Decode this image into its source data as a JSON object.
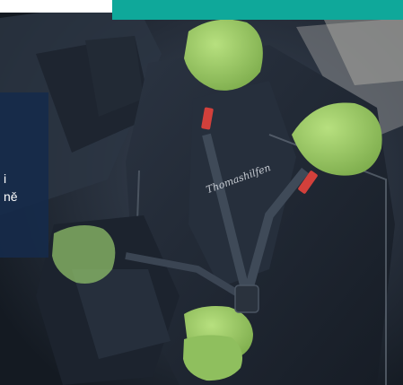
{
  "hero": {
    "brand_text": "Thomashilfen",
    "colors": {
      "seat": "#1f2631",
      "cushion_green": "#9ccb66",
      "buckle_red": "#d2403b",
      "panel": "#162a4a",
      "accent_teal": "#0fa89a"
    }
  },
  "info_panel": {
    "line1": "i",
    "line2": "ně"
  },
  "icons": {
    "brand-logo": "horse-logo-icon"
  }
}
